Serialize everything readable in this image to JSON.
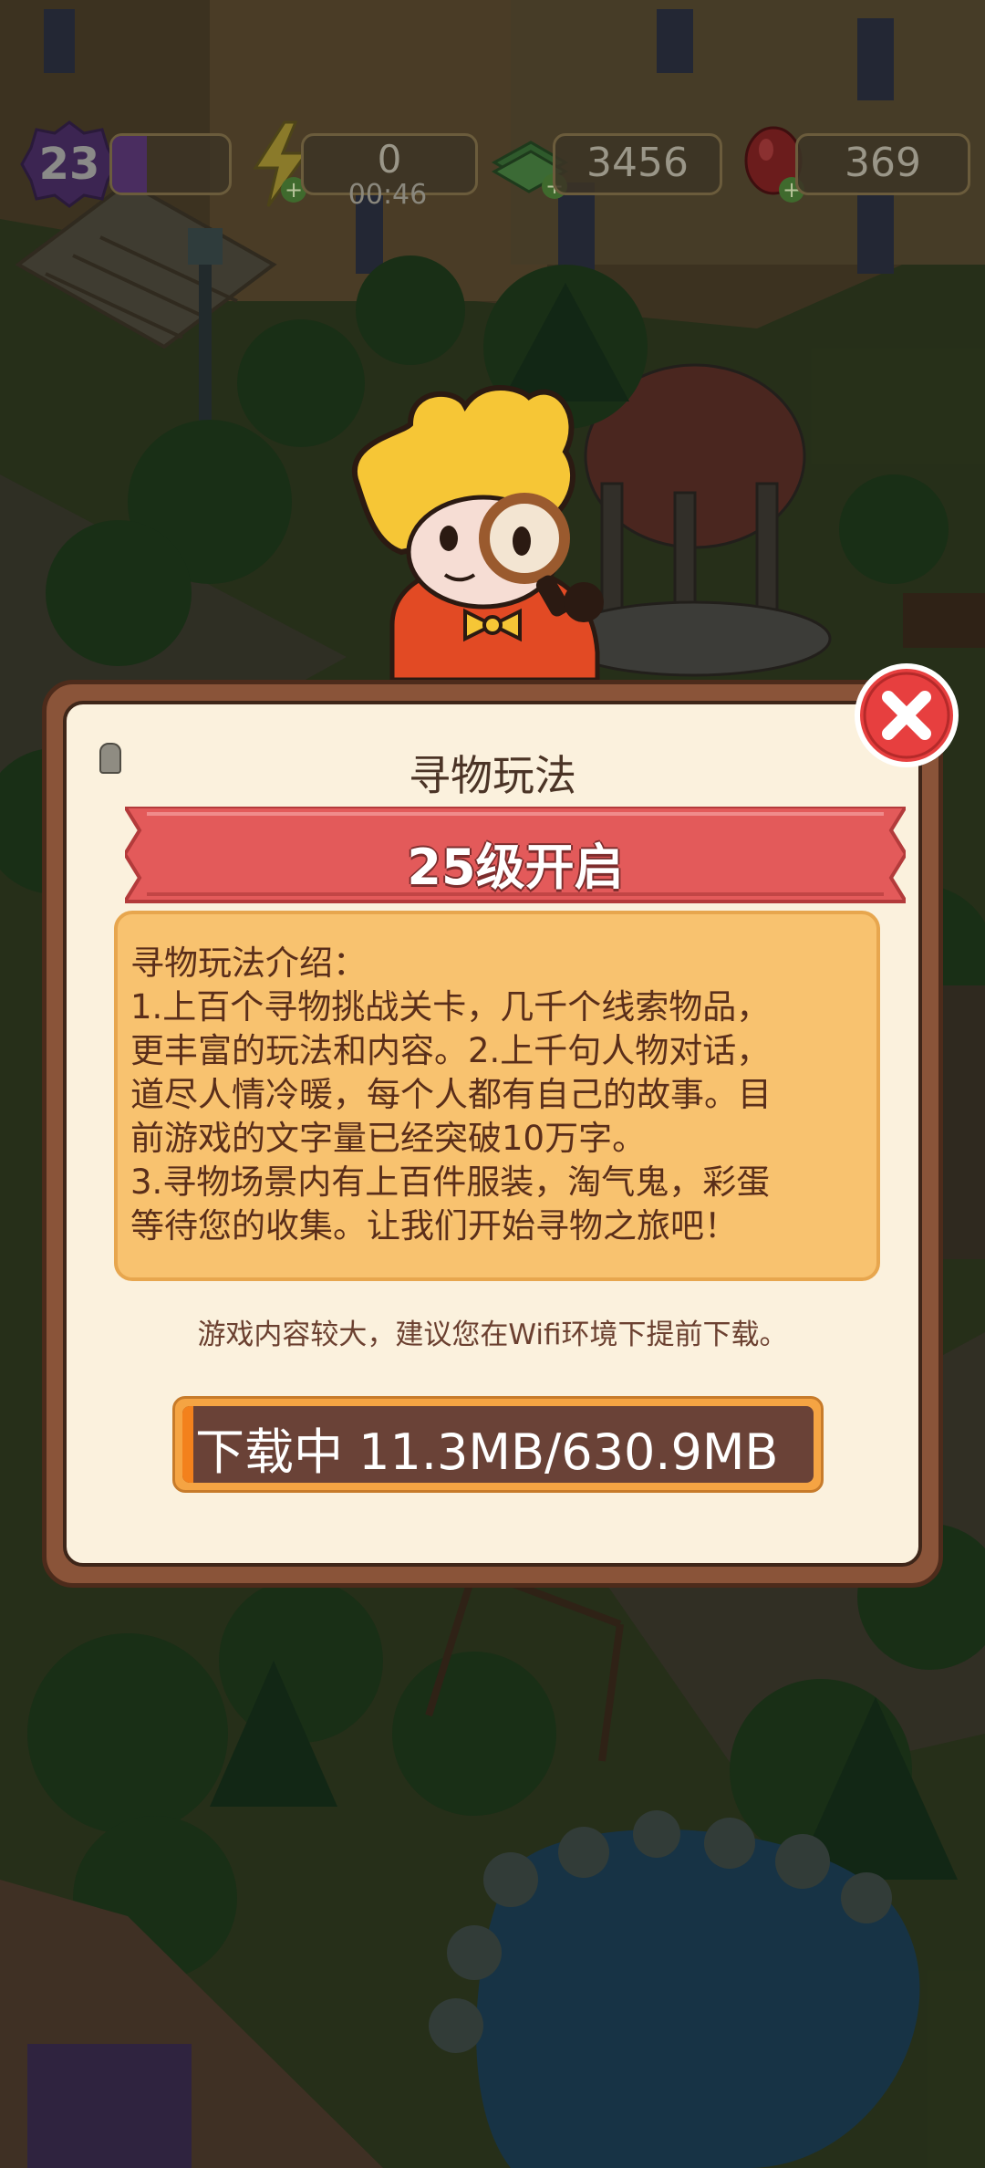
{
  "hud": {
    "level": "23",
    "xp_progress": 0.3,
    "energy": "0",
    "energy_timer": "00:46",
    "cash": "3456",
    "gems": "369"
  },
  "dialog": {
    "title": "寻物玩法",
    "unlock_banner": "25级开启",
    "intro_lines": [
      "寻物玩法介绍：",
      "1.上百个寻物挑战关卡，几千个线索物品，",
      "更丰富的玩法和内容。2.上千句人物对话，",
      "道尽人情冷暖，每个人都有自己的故事。目",
      "前游戏的文字量已经突破10万字。",
      "3.寻物场景内有上百件服装，淘气鬼，彩蛋",
      "等待您的收集。让我们开始寻物之旅吧！"
    ],
    "wifi_tip": "游戏内容较大，建议您在Wifi环境下提前下载。",
    "download_label": "下载中  11.3MB/630.9MB",
    "download_progress": 0.018
  },
  "colors": {
    "ribbon": "#e35a5a",
    "intro_bg": "#f8c26f",
    "progress_fill": "#f3811c",
    "close_button": "#e73f3f"
  }
}
